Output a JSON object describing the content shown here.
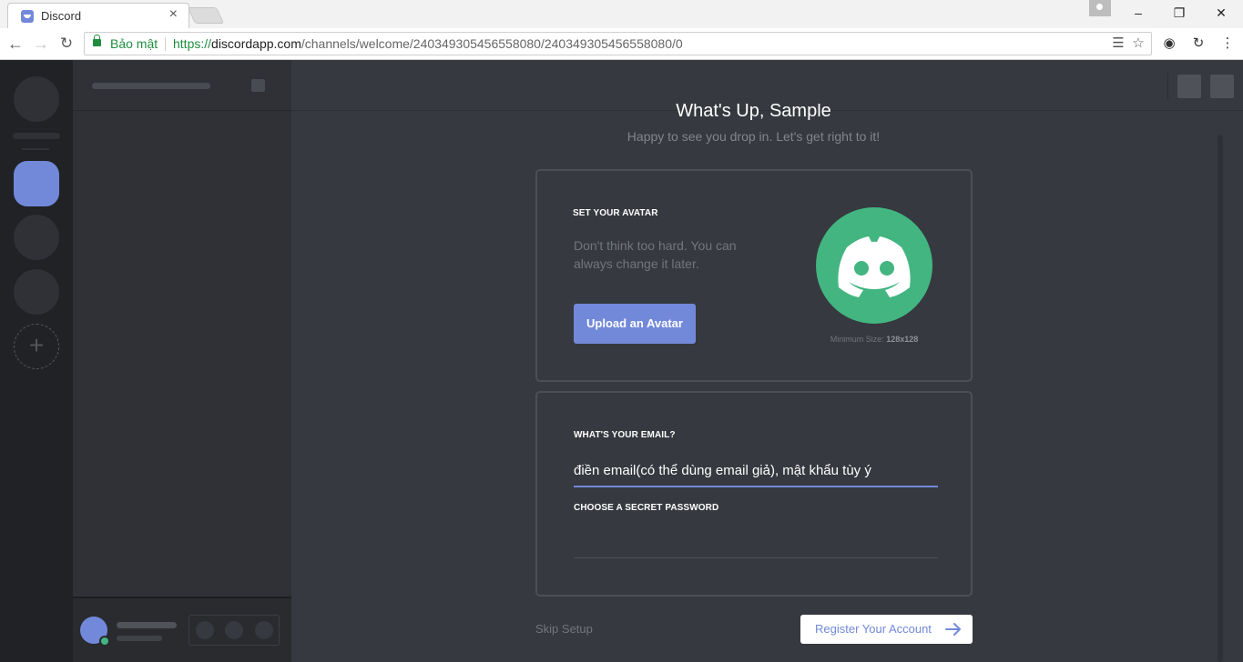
{
  "browser": {
    "tab_title": "Discord",
    "security_label": "Bảo mật",
    "url_protocol": "https://",
    "url_host": "discordapp.com",
    "url_path": "/channels/welcome/240349305456558080/240349305456558080/0"
  },
  "welcome": {
    "title": "What's Up, Sample",
    "subtitle": "Happy to see you drop in. Let's get right to it!"
  },
  "avatar_card": {
    "label": "SET YOUR AVATAR",
    "description": "Don't think too hard. You can always change it later.",
    "upload_button": "Upload an Avatar",
    "min_size_label": "Minimum Size:",
    "min_size_value": "128x128",
    "avatar_color": "#43b581"
  },
  "email_card": {
    "email_label": "WHAT'S YOUR EMAIL?",
    "email_value": "điền email(có thể dùng email giả), mật khẩu tùy ý",
    "password_label": "CHOOSE A SECRET PASSWORD",
    "password_value": ""
  },
  "footer": {
    "skip_label": "Skip Setup",
    "register_label": "Register Your Account"
  },
  "colors": {
    "accent": "#7289da",
    "online": "#43b581",
    "background": "#36393f"
  }
}
